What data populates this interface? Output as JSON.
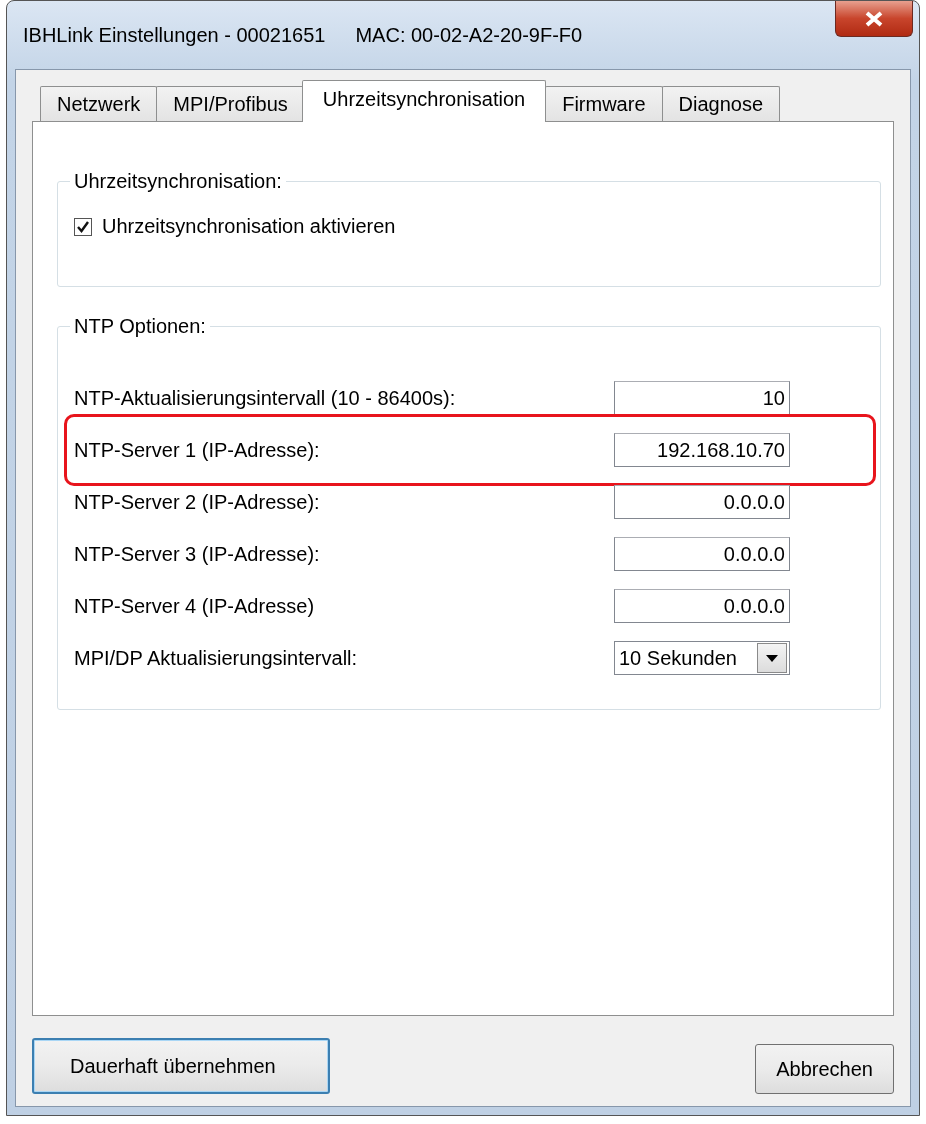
{
  "window": {
    "title": "IBHLink Einstellungen - 00021651",
    "mac": "MAC:  00-02-A2-20-9F-F0"
  },
  "tabs": [
    {
      "label": "Netzwerk",
      "selected": false
    },
    {
      "label": "MPI/Profibus",
      "selected": false
    },
    {
      "label": "Uhrzeitsynchronisation",
      "selected": true
    },
    {
      "label": "Firmware",
      "selected": false
    },
    {
      "label": "Diagnose",
      "selected": false
    }
  ],
  "sync_group": {
    "title": "Uhrzeitsynchronisation:",
    "checkbox": {
      "label": "Uhrzeitsynchronisation aktivieren",
      "checked": true
    }
  },
  "ntp_group": {
    "title": "NTP Optionen:",
    "rows": [
      {
        "kind": "text",
        "label": "NTP-Aktualisierungsintervall (10 - 86400s):",
        "value": "10",
        "highlighted": false
      },
      {
        "kind": "text",
        "label": "NTP-Server 1 (IP-Adresse):",
        "value": "192.168.10.70",
        "highlighted": true
      },
      {
        "kind": "text",
        "label": "NTP-Server 2 (IP-Adresse):",
        "value": "0.0.0.0",
        "highlighted": false
      },
      {
        "kind": "text",
        "label": "NTP-Server 3 (IP-Adresse):",
        "value": "0.0.0.0",
        "highlighted": false
      },
      {
        "kind": "text",
        "label": "NTP-Server 4 (IP-Adresse)",
        "value": "0.0.0.0",
        "highlighted": false
      },
      {
        "kind": "dropdown",
        "label": "MPI/DP Aktualisierungsintervall:",
        "value": "10 Sekunden",
        "highlighted": false
      }
    ]
  },
  "buttons": [
    {
      "label": "Dauerhaft übernehmen",
      "default": true
    },
    {
      "label": "Abbrechen",
      "default": false
    }
  ]
}
